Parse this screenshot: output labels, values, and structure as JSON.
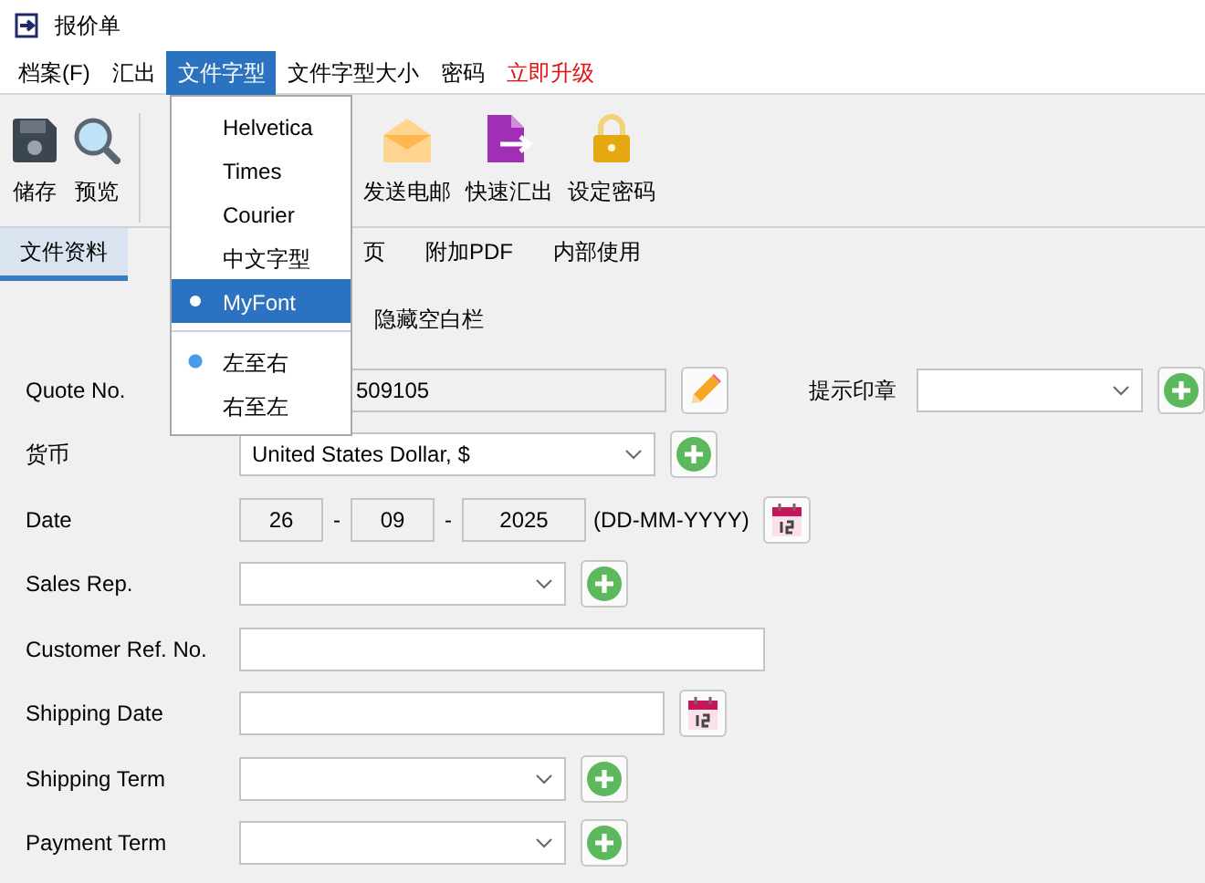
{
  "window": {
    "title": "报价单"
  },
  "menu_bar": [
    {
      "label": "档案(F)",
      "selected": false,
      "kind": "normal"
    },
    {
      "label": "汇出",
      "selected": false,
      "kind": "normal"
    },
    {
      "label": "文件字型",
      "selected": true,
      "kind": "normal"
    },
    {
      "label": "文件字型大小",
      "selected": false,
      "kind": "normal"
    },
    {
      "label": "密码",
      "selected": false,
      "kind": "normal"
    },
    {
      "label": "立即升级",
      "selected": false,
      "kind": "upgrade"
    }
  ],
  "font_menu": {
    "fonts": [
      {
        "label": "Helvetica",
        "selected": false
      },
      {
        "label": "Times",
        "selected": false
      },
      {
        "label": "Courier",
        "selected": false
      },
      {
        "label": "中文字型",
        "selected": false
      },
      {
        "label": "MyFont",
        "selected": true
      }
    ],
    "directions": [
      {
        "label": "左至右",
        "selected": true
      },
      {
        "label": "右至左",
        "selected": false
      }
    ]
  },
  "toolbar": {
    "left": [
      {
        "label": "储存",
        "kind": "save"
      },
      {
        "label": "预览",
        "kind": "preview"
      }
    ],
    "right": [
      {
        "label": "发送电邮",
        "kind": "email"
      },
      {
        "label": "快速汇出",
        "kind": "export"
      },
      {
        "label": "设定密码",
        "kind": "lock"
      }
    ]
  },
  "tabs": [
    {
      "label": "文件资料",
      "selected": true
    },
    {
      "label": "页",
      "selected": false
    },
    {
      "label": "附加PDF",
      "selected": false
    },
    {
      "label": "内部使用",
      "selected": false
    }
  ],
  "option_label": "隐藏空白栏",
  "form": [
    {
      "label": "Quote No.",
      "kind": "quote",
      "value": "509105",
      "button": {
        "kind": "edit"
      },
      "side": {
        "label": "提示印章",
        "kind": "select",
        "button": {
          "kind": "add"
        }
      }
    },
    {
      "label": "货币",
      "kind": "select-wide",
      "value": "United States Dollar, $",
      "button": {
        "kind": "add"
      }
    },
    {
      "label": "Date",
      "kind": "date",
      "parts": [
        "26",
        "09",
        "2025"
      ],
      "separators": [
        "-",
        "-"
      ],
      "hint": "(DD-MM-YYYY)",
      "button": {
        "kind": "calendar"
      }
    },
    {
      "label": "Sales Rep.",
      "kind": "select",
      "button": {
        "kind": "add"
      }
    },
    {
      "label": "Customer Ref. No.",
      "kind": "text-long"
    },
    {
      "label": "Shipping Date",
      "kind": "text-medium",
      "button": {
        "kind": "calendar"
      }
    },
    {
      "label": "Shipping Term",
      "kind": "select",
      "button": {
        "kind": "add"
      }
    },
    {
      "label": "Payment Term",
      "kind": "select",
      "button": {
        "kind": "add"
      }
    }
  ]
}
